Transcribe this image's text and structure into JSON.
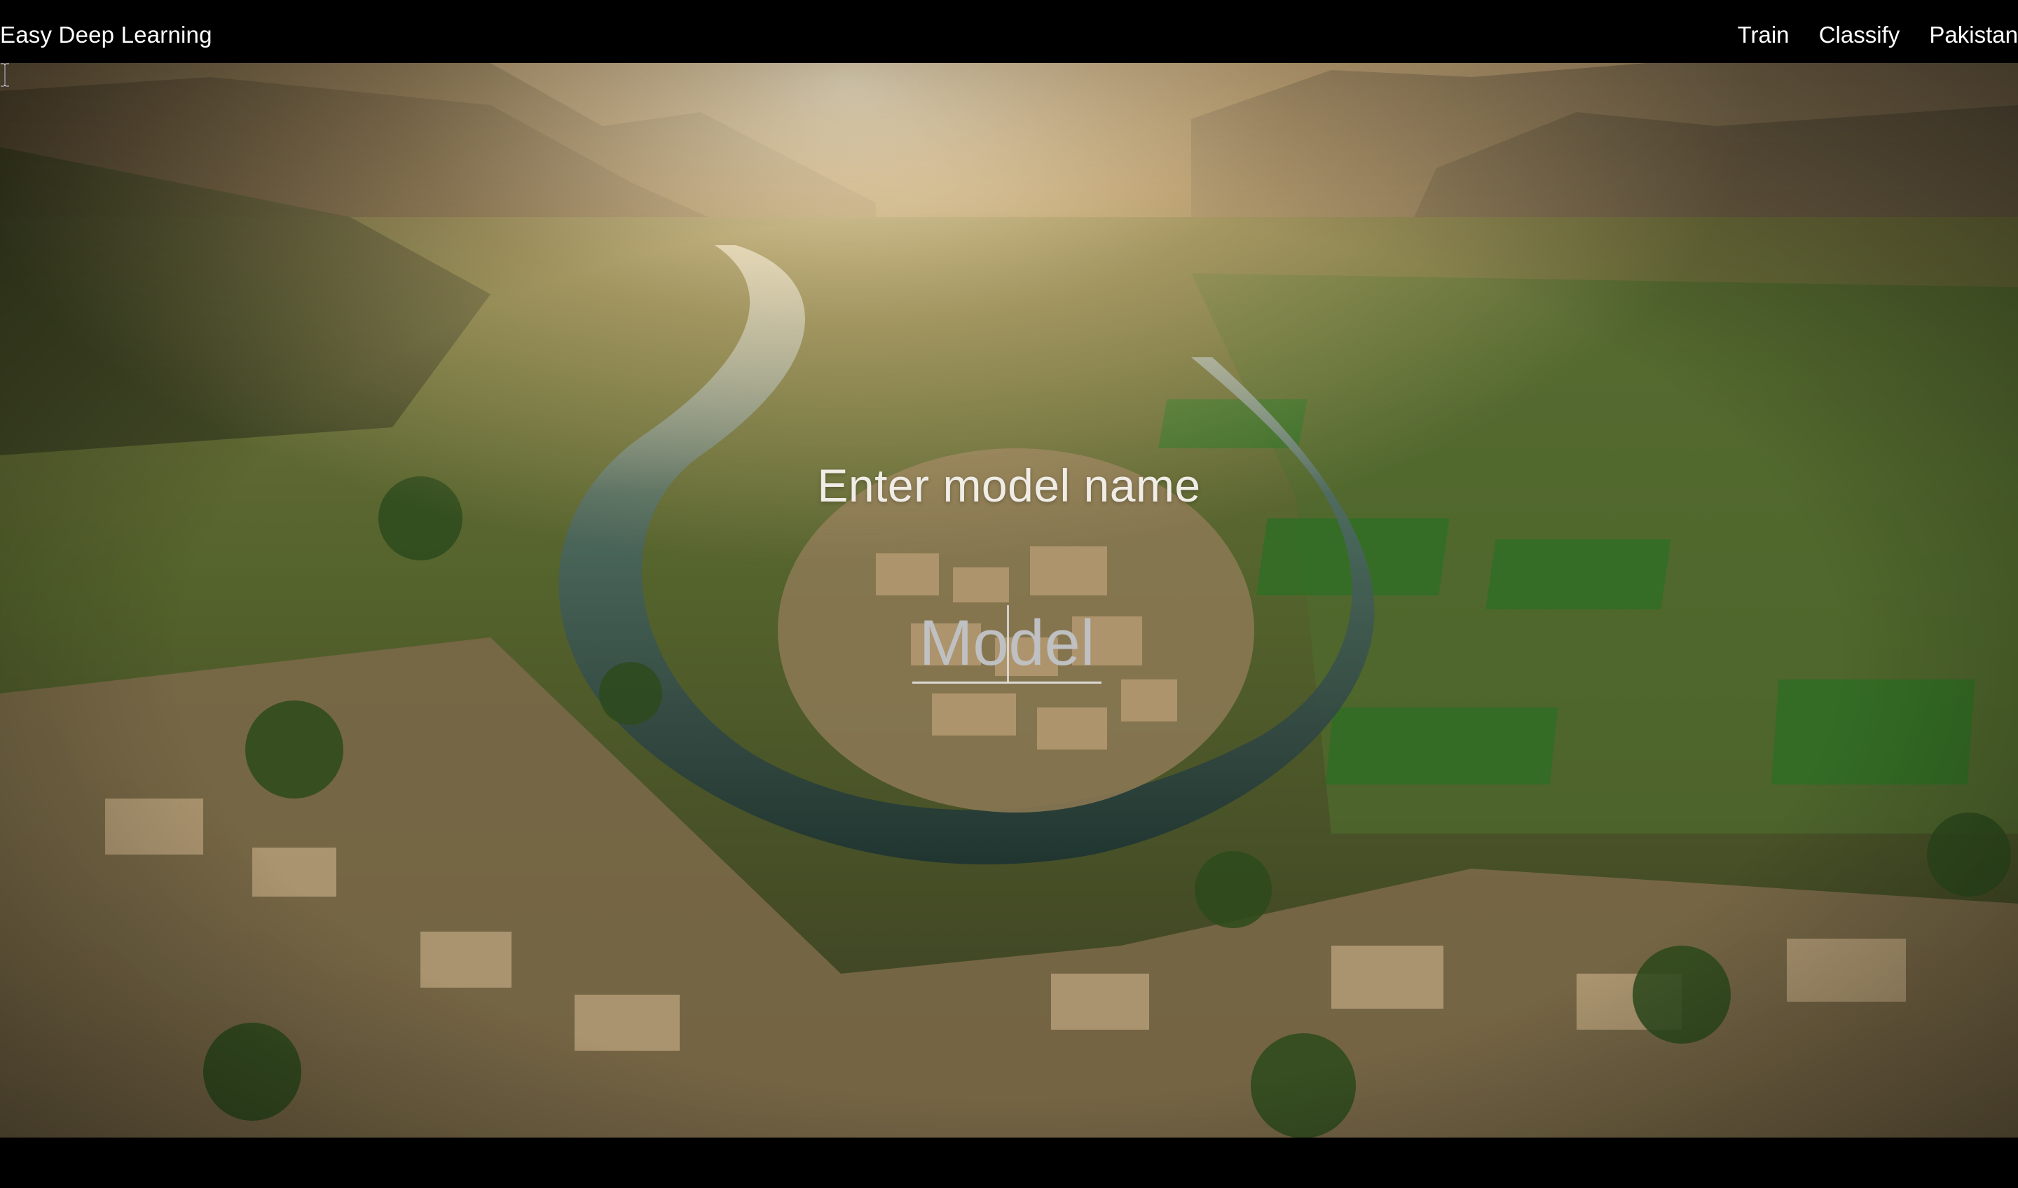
{
  "header": {
    "brand": "Easy Deep Learning",
    "nav": [
      "Train",
      "Classify",
      "Pakistan"
    ]
  },
  "main": {
    "prompt": "Enter model name",
    "input": {
      "placeholder": "Model",
      "value": ""
    }
  },
  "icons": {
    "cursor": "text-cursor-icon"
  }
}
